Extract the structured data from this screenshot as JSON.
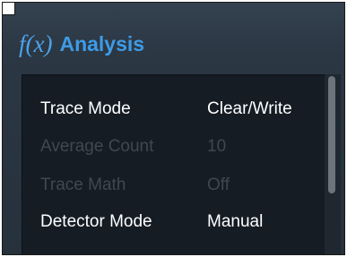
{
  "header": {
    "icon_text": "f(x)",
    "title": "Analysis"
  },
  "menu": {
    "items": [
      {
        "label": "Trace Mode",
        "value": "Clear/Write",
        "enabled": true
      },
      {
        "label": "Average Count",
        "value": "10",
        "enabled": false
      },
      {
        "label": "Trace Math",
        "value": "Off",
        "enabled": false
      },
      {
        "label": "Detector Mode",
        "value": "Manual",
        "enabled": true
      }
    ]
  },
  "colors": {
    "accent": "#3e9be6",
    "panel_bg": "#151c24",
    "frame_bg": "#2b3743",
    "text_enabled": "#ffffff",
    "text_disabled": "#3f4850"
  }
}
